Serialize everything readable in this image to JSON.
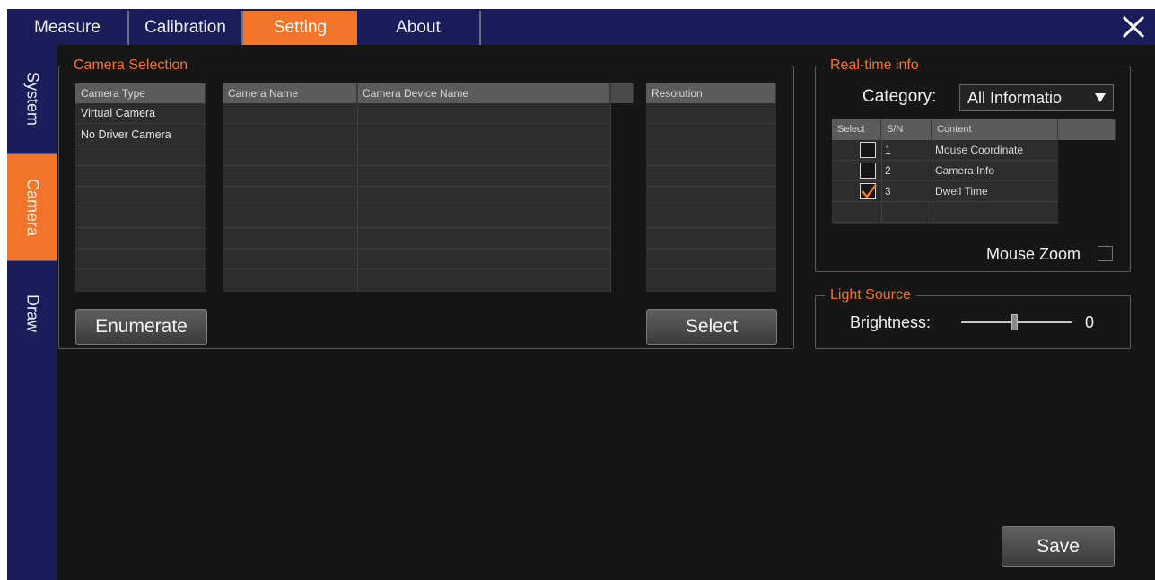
{
  "top_tabs": [
    "Measure",
    "Calibration",
    "Setting",
    "About"
  ],
  "side_tabs": [
    "System",
    "Camera",
    "Draw"
  ],
  "camera_selection": {
    "title": "Camera Selection",
    "type_header": "Camera Type",
    "camera_types": [
      "Virtual Camera",
      "No Driver Camera"
    ],
    "name_header": "Camera Name",
    "device_header": "Camera Device Name",
    "resolution_header": "Resolution",
    "enumerate_label": "Enumerate",
    "select_label": "Select"
  },
  "realtime": {
    "title": "Real-time info",
    "category_label": "Category:",
    "category_value": "All Informatio",
    "headers": [
      "Select",
      "S/N",
      "Content"
    ],
    "rows": [
      {
        "sn": "1",
        "content": "Mouse Coordinate",
        "checked": false
      },
      {
        "sn": "2",
        "content": "Camera Info",
        "checked": false
      },
      {
        "sn": "3",
        "content": "Dwell Time",
        "checked": true
      }
    ],
    "mouse_zoom_label": "Mouse Zoom",
    "mouse_zoom_checked": false
  },
  "light_source": {
    "title": "Light Source",
    "brightness_label": "Brightness:",
    "brightness_value": "0"
  },
  "save_label": "Save",
  "colors": {
    "accent": "#f27428",
    "bar": "#1b1d5a",
    "background": "#161616"
  }
}
